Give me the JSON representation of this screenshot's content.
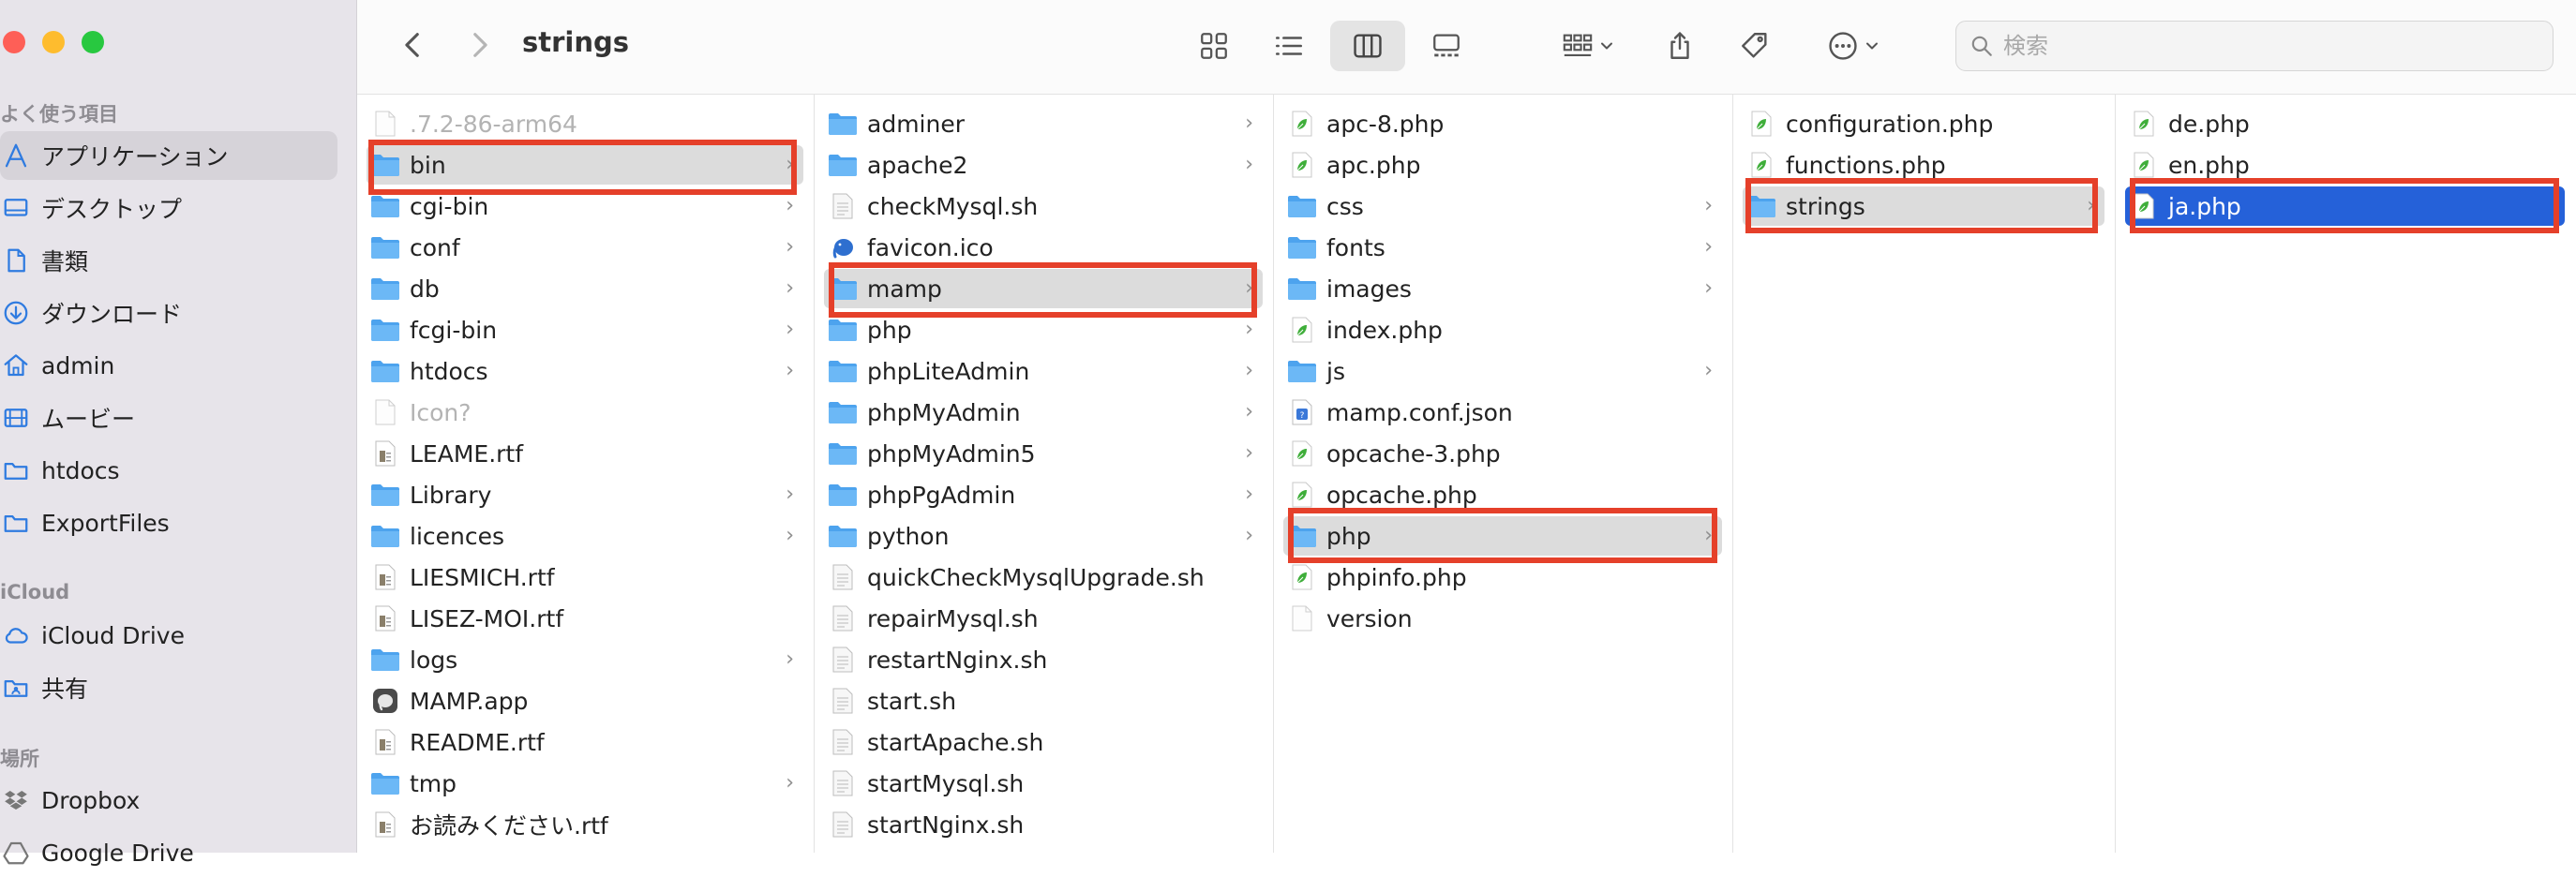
{
  "window": {
    "title": "strings"
  },
  "toolbar": {
    "search_placeholder": "検索"
  },
  "sidebar": {
    "sections": [
      {
        "label": "よく使う項目"
      },
      {
        "label": "iCloud"
      },
      {
        "label": "場所"
      }
    ],
    "favorites": [
      {
        "label": "アプリケーション",
        "icon": "applications-icon",
        "active": true
      },
      {
        "label": "デスクトップ",
        "icon": "desktop-icon"
      },
      {
        "label": "書類",
        "icon": "document-icon"
      },
      {
        "label": "ダウンロード",
        "icon": "download-icon"
      },
      {
        "label": "admin",
        "icon": "home-icon"
      },
      {
        "label": "ムービー",
        "icon": "film-icon"
      },
      {
        "label": "htdocs",
        "icon": "folder-icon"
      },
      {
        "label": "ExportFiles",
        "icon": "folder-icon"
      }
    ],
    "icloud": [
      {
        "label": "iCloud Drive",
        "icon": "cloud-icon"
      },
      {
        "label": "共有",
        "icon": "shared-folder-icon"
      }
    ],
    "places": [
      {
        "label": "Dropbox",
        "icon": "dropbox-icon"
      },
      {
        "label": "Google Drive",
        "icon": "google-drive-icon"
      }
    ]
  },
  "columns": [
    {
      "items": [
        {
          "name": ".7.2-86-arm64",
          "kind": "file",
          "dim": true
        },
        {
          "name": "bin",
          "kind": "folder",
          "selected": "gray"
        },
        {
          "name": "cgi-bin",
          "kind": "folder"
        },
        {
          "name": "conf",
          "kind": "folder"
        },
        {
          "name": "db",
          "kind": "folder"
        },
        {
          "name": "fcgi-bin",
          "kind": "folder"
        },
        {
          "name": "htdocs",
          "kind": "folder"
        },
        {
          "name": "Icon?",
          "kind": "file",
          "dim": true
        },
        {
          "name": "LEAME.rtf",
          "kind": "rtf"
        },
        {
          "name": "Library",
          "kind": "folder"
        },
        {
          "name": "licences",
          "kind": "folder"
        },
        {
          "name": "LIESMICH.rtf",
          "kind": "rtf"
        },
        {
          "name": "LISEZ-MOI.rtf",
          "kind": "rtf"
        },
        {
          "name": "logs",
          "kind": "folder"
        },
        {
          "name": "MAMP.app",
          "kind": "app"
        },
        {
          "name": "README.rtf",
          "kind": "rtf"
        },
        {
          "name": "tmp",
          "kind": "folder"
        },
        {
          "name": "お読みください.rtf",
          "kind": "rtf"
        }
      ]
    },
    {
      "items": [
        {
          "name": "adminer",
          "kind": "folder"
        },
        {
          "name": "apache2",
          "kind": "folder"
        },
        {
          "name": "checkMysql.sh",
          "kind": "script"
        },
        {
          "name": "favicon.ico",
          "kind": "ico"
        },
        {
          "name": "mamp",
          "kind": "folder",
          "selected": "gray"
        },
        {
          "name": "php",
          "kind": "folder"
        },
        {
          "name": "phpLiteAdmin",
          "kind": "folder"
        },
        {
          "name": "phpMyAdmin",
          "kind": "folder"
        },
        {
          "name": "phpMyAdmin5",
          "kind": "folder"
        },
        {
          "name": "phpPgAdmin",
          "kind": "folder"
        },
        {
          "name": "python",
          "kind": "folder"
        },
        {
          "name": "quickCheckMysqlUpgrade.sh",
          "kind": "script"
        },
        {
          "name": "repairMysql.sh",
          "kind": "script"
        },
        {
          "name": "restartNginx.sh",
          "kind": "script"
        },
        {
          "name": "start.sh",
          "kind": "script"
        },
        {
          "name": "startApache.sh",
          "kind": "script"
        },
        {
          "name": "startMysql.sh",
          "kind": "script"
        },
        {
          "name": "startNginx.sh",
          "kind": "script"
        }
      ]
    },
    {
      "items": [
        {
          "name": "apc-8.php",
          "kind": "php"
        },
        {
          "name": "apc.php",
          "kind": "php"
        },
        {
          "name": "css",
          "kind": "folder"
        },
        {
          "name": "fonts",
          "kind": "folder"
        },
        {
          "name": "images",
          "kind": "folder"
        },
        {
          "name": "index.php",
          "kind": "php"
        },
        {
          "name": "js",
          "kind": "folder"
        },
        {
          "name": "mamp.conf.json",
          "kind": "json"
        },
        {
          "name": "opcache-3.php",
          "kind": "php"
        },
        {
          "name": "opcache.php",
          "kind": "php"
        },
        {
          "name": "php",
          "kind": "folder",
          "selected": "gray"
        },
        {
          "name": "phpinfo.php",
          "kind": "php"
        },
        {
          "name": "version",
          "kind": "file"
        }
      ]
    },
    {
      "items": [
        {
          "name": "configuration.php",
          "kind": "php"
        },
        {
          "name": "functions.php",
          "kind": "php"
        },
        {
          "name": "strings",
          "kind": "folder",
          "selected": "gray"
        }
      ]
    },
    {
      "items": [
        {
          "name": "de.php",
          "kind": "php"
        },
        {
          "name": "en.php",
          "kind": "php"
        },
        {
          "name": "ja.php",
          "kind": "php",
          "selected": "blue"
        }
      ]
    }
  ],
  "colors": {
    "highlight_box": "#e5402a",
    "selection_blue": "#2561d9",
    "folder_blue": "#5aaef0"
  }
}
